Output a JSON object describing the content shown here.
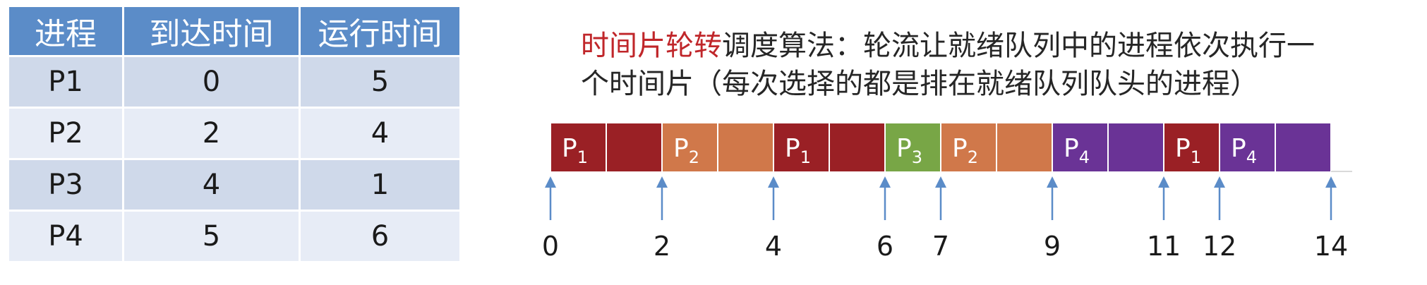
{
  "table": {
    "headers": [
      "进程",
      "到达时间",
      "运行时间"
    ],
    "rows": [
      {
        "process": "P1",
        "arrival": "0",
        "run": "5"
      },
      {
        "process": "P2",
        "arrival": "2",
        "run": "4"
      },
      {
        "process": "P3",
        "arrival": "4",
        "run": "1"
      },
      {
        "process": "P4",
        "arrival": "5",
        "run": "6"
      }
    ]
  },
  "description": {
    "highlight": "时间片轮转",
    "rest_line1": "调度算法：轮流让就绪队列中的进程依次执行一",
    "line2": "个时间片（每次选择的都是排在就绪队列队头的进程）"
  },
  "colors": {
    "P1": "#9a2025",
    "P2": "#d0784a",
    "P3": "#78a646",
    "P4": "#6a3396"
  },
  "gantt": {
    "unit_time": 1,
    "segments": [
      {
        "process": "P1",
        "base": "P",
        "sub": "1",
        "start": 0,
        "end": 2
      },
      {
        "process": "P2",
        "base": "P",
        "sub": "2",
        "start": 2,
        "end": 4
      },
      {
        "process": "P1",
        "base": "P",
        "sub": "1",
        "start": 4,
        "end": 6
      },
      {
        "process": "P3",
        "base": "P",
        "sub": "3",
        "start": 6,
        "end": 7
      },
      {
        "process": "P2",
        "base": "P",
        "sub": "2",
        "start": 7,
        "end": 9
      },
      {
        "process": "P4",
        "base": "P",
        "sub": "4",
        "start": 9,
        "end": 11
      },
      {
        "process": "P1",
        "base": "P",
        "sub": "1",
        "start": 11,
        "end": 12
      },
      {
        "process": "P4",
        "base": "P",
        "sub": "4",
        "start": 12,
        "end": 14
      }
    ],
    "ticks": [
      "0",
      "2",
      "4",
      "6",
      "7",
      "9",
      "11",
      "12",
      "14"
    ]
  }
}
